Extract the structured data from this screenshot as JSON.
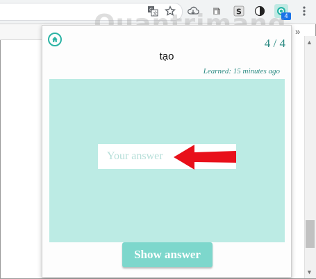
{
  "watermark": "Quantrimang",
  "extension": {
    "badge": "4"
  },
  "toolbar_icons": [
    "translate-icon",
    "star-icon",
    "cloud-download-icon",
    "extension-icon",
    "s-extension-icon",
    "dark-mode-icon",
    "flashcard-extension-icon",
    "menu-dots-icon"
  ],
  "popup": {
    "counter": "4 / 4",
    "word": "tạo",
    "learned": "Learned: 15 minutes ago",
    "answer": {
      "value": "",
      "placeholder": "Your answer"
    },
    "show_answer_label": "Show answer"
  },
  "colors": {
    "accent": "#2bb3a4",
    "card_bg": "#bcebe4",
    "button_bg": "#7dd7cc",
    "arrow": "#e8101a"
  }
}
